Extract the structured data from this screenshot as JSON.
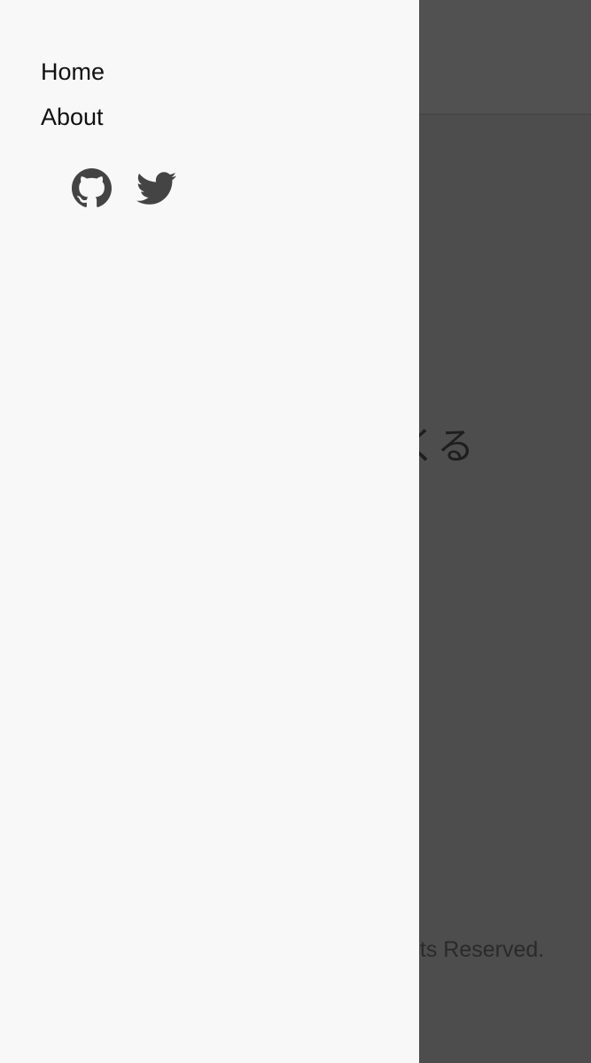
{
  "background": {
    "heading_fragment": "くる",
    "footer_fragment": "hts Reserved."
  },
  "drawer": {
    "nav_items": [
      {
        "label": "Home"
      },
      {
        "label": "About"
      }
    ],
    "social": [
      {
        "icon": "github-icon"
      },
      {
        "icon": "twitter-icon"
      }
    ]
  },
  "colors": {
    "drawer_bg": "#f8f8f8",
    "overlay": "#4d4d4d",
    "icon": "#444444"
  }
}
